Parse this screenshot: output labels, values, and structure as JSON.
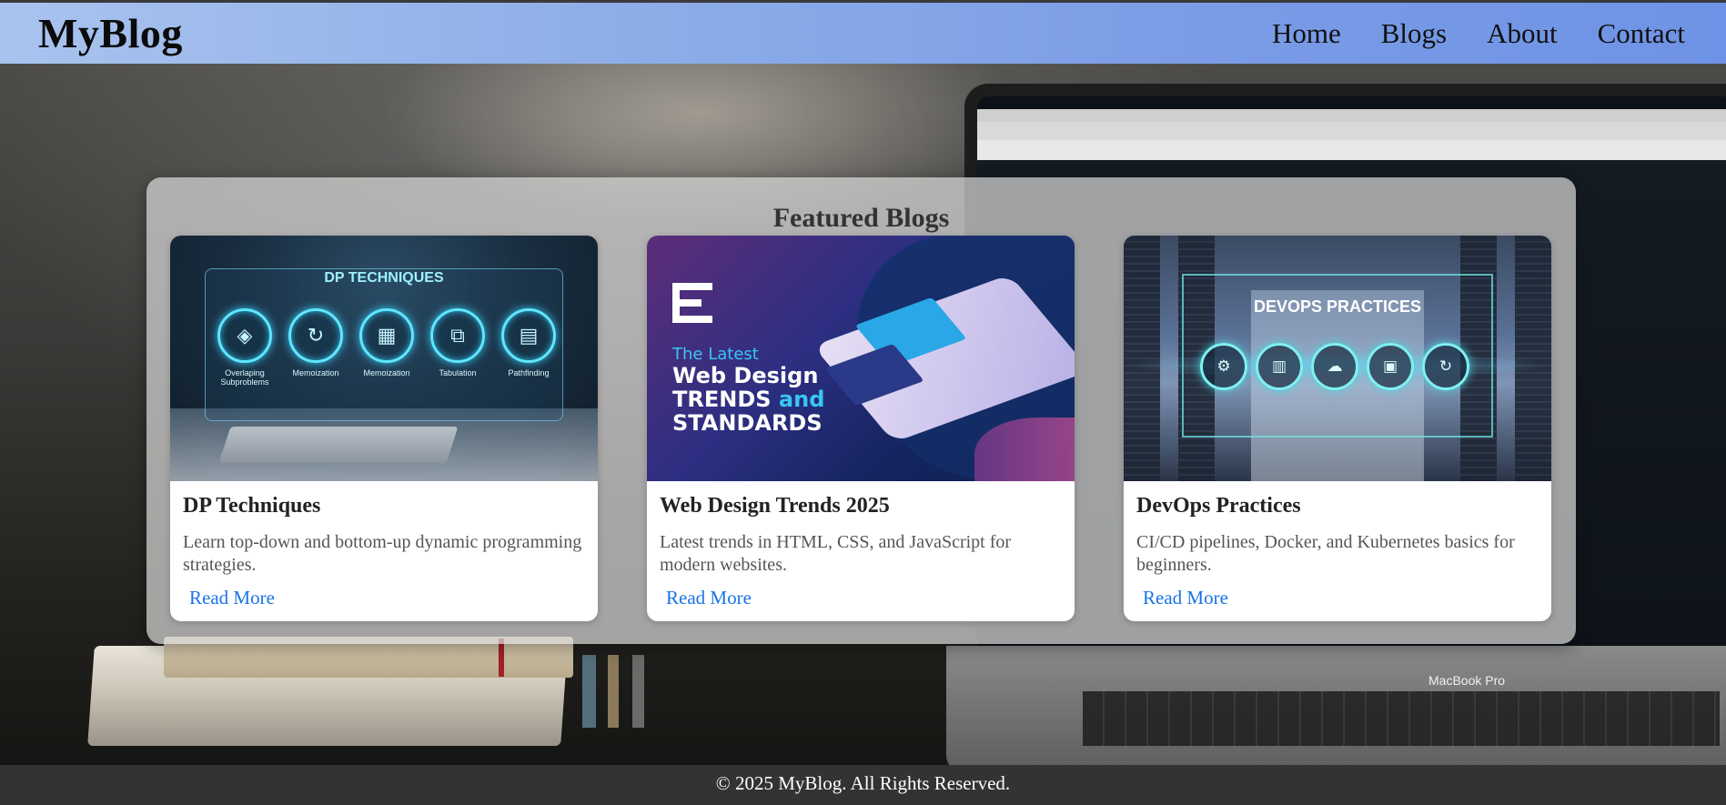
{
  "header": {
    "logo": "MyBlog",
    "nav": [
      "Home",
      "Blogs",
      "About",
      "Contact"
    ]
  },
  "featured": {
    "title": "Featured Blogs",
    "cards": [
      {
        "title": "DP Techniques",
        "description": "Learn top-down and bottom-up dynamic programming strategies.",
        "link": "Read More",
        "image": {
          "heading": "DP TECHNIQUES",
          "labels": [
            "Overlaping Subproblems",
            "Memoization",
            "Memoization",
            "Tabulation",
            "Pathfinding"
          ]
        }
      },
      {
        "title": "Web Design Trends 2025",
        "description": "Latest trends in HTML, CSS, and JavaScript for modern websites.",
        "link": "Read More",
        "image": {
          "line1": "The Latest",
          "line2": "Web Design",
          "line3a": "TRENDS",
          "line3b": "and",
          "line4": "STANDARDS"
        }
      },
      {
        "title": "DevOps Practices",
        "description": "CI/CD pipelines, Docker, and Kubernetes basics for beginners.",
        "link": "Read More",
        "image": {
          "heading": "DEVOPS PRACTICES"
        }
      }
    ]
  },
  "background": {
    "laptop_label": "MacBook Pro"
  },
  "footer": {
    "text": "© 2025 MyBlog. All Rights Reserved."
  },
  "colors": {
    "link": "#1a73e8",
    "footer_bg": "#333333",
    "header_gradient_start": "#a9c3ee",
    "header_gradient_end": "#6e93e6"
  }
}
